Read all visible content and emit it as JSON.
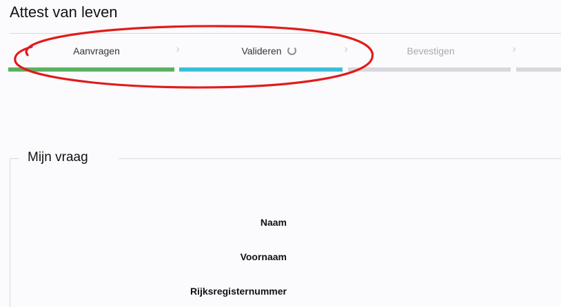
{
  "page": {
    "title": "Attest van leven"
  },
  "stepper": {
    "steps": [
      {
        "label": "Aanvragen",
        "state": "completed",
        "color": "#5bb163"
      },
      {
        "label": "Valideren",
        "state": "in-progress",
        "color": "#3bbfd9",
        "icon": "loading-spinner-icon"
      },
      {
        "label": "Bevestigen",
        "state": "pending",
        "color": "#d8d8dc"
      }
    ],
    "separator_icon": "chevron-right-icon",
    "chevron": "›"
  },
  "annotation": {
    "shape": "ellipse",
    "color": "#e01b1b"
  },
  "section": {
    "legend": "Mijn vraag",
    "fields": [
      {
        "label": "Naam"
      },
      {
        "label": "Voornaam"
      },
      {
        "label": "Rijksregisternummer"
      }
    ]
  }
}
